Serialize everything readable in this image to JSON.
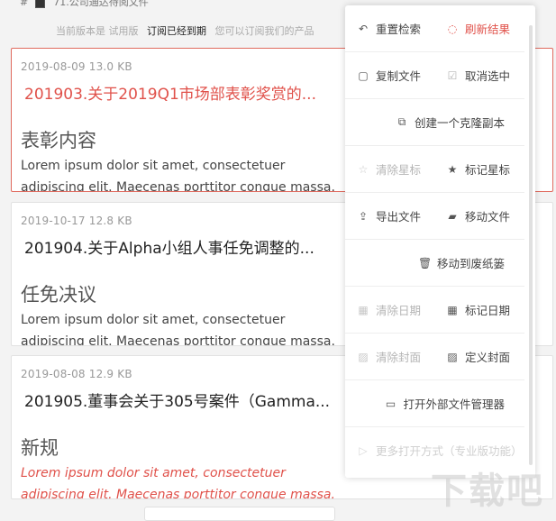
{
  "breadcrumb": {
    "hash": "#",
    "text": "71.公司通达待阅文件"
  },
  "version_bar": {
    "prefix": "当前版本是 试用版",
    "status": "订阅已经到期",
    "suffix": "您可以订阅我们的产品"
  },
  "notes": [
    {
      "meta": "2019-08-09  13.0 KB",
      "title": "201903.关于2019Q1市场部表彰奖赏的...",
      "heading": "表彰内容",
      "body_lines": [
        "Lorem ipsum dolor sit amet, consectetuer",
        "adipiscing elit. Maecenas porttitor congue massa."
      ]
    },
    {
      "meta": "2019-10-17  12.8 KB",
      "title": "201904.关于Alpha小组人事任免调整的...",
      "heading": "任免决议",
      "body_lines": [
        "Lorem ipsum dolor sit amet, consectetuer",
        "adipiscing elit. Maecenas porttitor congue massa."
      ]
    },
    {
      "meta": "2019-08-08  12.9 KB",
      "title": "201905.董事会关于305号案件（Gamma...",
      "heading": "新规",
      "body_lines": [
        "Lorem ipsum dolor sit amet, consectetuer",
        "adipiscing elit. Maecenas porttitor congue massa."
      ]
    }
  ],
  "menu": {
    "reset_search": "重置检索",
    "refresh_results": "刷新结果",
    "copy_file": "复制文件",
    "deselect": "取消选中",
    "create_clone": "创建一个克隆副本",
    "clear_star": "清除星标",
    "mark_star": "标记星标",
    "export_file": "导出文件",
    "move_file": "移动文件",
    "move_to_trash": "移动到废纸篓",
    "clear_date": "清除日期",
    "mark_date": "标记日期",
    "clear_cover": "清除封面",
    "set_cover": "定义封面",
    "open_external": "打开外部文件管理器",
    "more_open": "更多打开方式（专业版功能）"
  },
  "icons": {
    "reset": "↶",
    "refresh": "◌",
    "copy": "▢",
    "check": "☑",
    "clone": "⧉",
    "star_empty": "☆",
    "star": "★",
    "export": "⇪",
    "truck": "▰",
    "trash": "🗑",
    "calendar": "▦",
    "image": "▨",
    "monitor": "▭",
    "play": "▷"
  },
  "colors": {
    "accent": "#e0514a",
    "active_border": "#e06a5e"
  },
  "watermark": "下载吧"
}
